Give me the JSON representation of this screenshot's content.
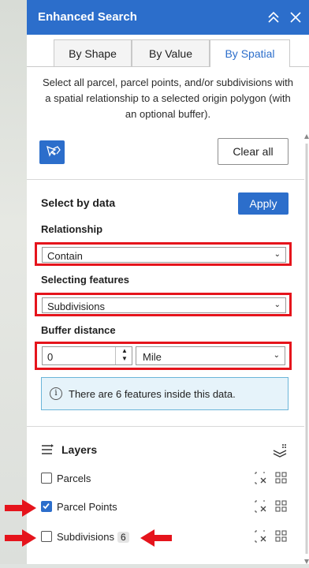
{
  "header": {
    "title": "Enhanced Search"
  },
  "tabs": [
    {
      "label": "By Shape"
    },
    {
      "label": "By Value"
    },
    {
      "label": "By Spatial"
    }
  ],
  "description": [
    "Select all parcel, parcel points, and/or subdivisions with",
    "a spatial relationship to a selected origin polygon (with",
    "an optional buffer)."
  ],
  "toolbar": {
    "clear_label": "Clear all"
  },
  "select_by_data": {
    "title": "Select by data",
    "apply_label": "Apply",
    "relationship": {
      "label": "Relationship",
      "value": "Contain"
    },
    "selecting_features": {
      "label": "Selecting features",
      "value": "Subdivisions"
    },
    "buffer": {
      "label": "Buffer distance",
      "value": "0",
      "unit": "Mile"
    },
    "notice": "There are 6 features inside this data."
  },
  "layers": {
    "title": "Layers",
    "items": [
      {
        "name": "Parcels",
        "checked": false,
        "count": ""
      },
      {
        "name": "Parcel Points",
        "checked": true,
        "count": ""
      },
      {
        "name": "Subdivisions",
        "checked": false,
        "count": "6"
      }
    ]
  },
  "colors": {
    "accent": "#2c6ecb",
    "highlight": "#e5141c",
    "notice_bg": "#e6f3fa"
  },
  "icons": [
    "collapse-icon",
    "close-icon",
    "select-tool-icon",
    "info-icon",
    "layers-list-icon",
    "layer-stack-icon",
    "clear-selection-icon",
    "select-all-icon",
    "red-arrow"
  ]
}
